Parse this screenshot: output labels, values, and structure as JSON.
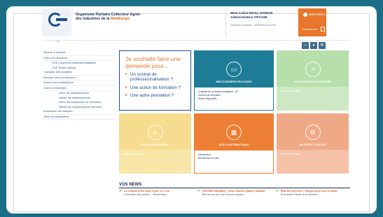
{
  "header": {
    "org_name_line1": "Organisme Paritaire Collecteur Agréé",
    "org_name_line2_prefix": "des Industries de la ",
    "org_name_line2_accent": "Métallurgie",
    "user_name": "Mme Coline MOAL-VIGNON",
    "user_role": "Administrateur OPCAIM",
    "last_connection": "Dernière connexion : 05/02/2015 à 23:54",
    "profile_label": "MON PROFIL",
    "logout_label": "Déconnexion"
  },
  "quick_icons": [
    "home-icon",
    "bell-icon",
    "mail-icon"
  ],
  "sidebar": {
    "items": [
      {
        "label": "Revenir à l'accueil",
        "level": 0
      },
      {
        "label": "Faire une demande",
        "level": 0
      },
      {
        "label": "SGE Contrat de professionnalisation",
        "level": 1
      },
      {
        "label": "SGE Toutes actions",
        "level": 1
      },
      {
        "label": "Consulter mes dossiers",
        "level": 0
      },
      {
        "label": "Déclarer mes contributions",
        "level": 0
      },
      {
        "label": "Suivre mes contributions",
        "level": 0
      },
      {
        "label": "Gérer le référentiel",
        "level": 0
      },
      {
        "label": "Gérer les établissements",
        "level": 1
      },
      {
        "label": "Valider les établissements",
        "level": 1
      },
      {
        "label": "Gérer les organismes de formation",
        "level": 1
      },
      {
        "label": "Valider les organismes de formation",
        "level": 1
      },
      {
        "label": "Administrer les comptes",
        "level": 0
      },
      {
        "label": "Gérer les paramètres",
        "level": 0
      }
    ]
  },
  "callout": {
    "title": "Je souhaite faire une demande pour...",
    "items": [
      "Un contrat de professionnalisation ?",
      "Une action de formation ?",
      "Une autre prestation ?"
    ]
  },
  "tiles": {
    "dossiers": {
      "label": "MES DOSSIERS EN COURS",
      "lines": [
        "Contrats de professionnalisation : 42",
        "Actions de formation",
        "Autres dispositifs"
      ]
    },
    "synthese": {
      "label": "MA SYNTHÈSE FINANCIÈRE",
      "lines": [
        "Bientôt disponible..."
      ]
    },
    "finance": {
      "label": "MES FINANCEMENTS",
      "lines": [
        "Bientôt disponible..."
      ]
    },
    "contributions": {
      "label": "MES CONTRIBUTIONS",
      "lines": [
        "Déclaration",
        "Bordereaux et suivi"
      ]
    },
    "outils": {
      "label": "MA BOITE À OUTILS",
      "lines": [
        "Bientôt disponible..."
      ]
    }
  },
  "news": {
    "title": "VOS NEWS",
    "items": [
      {
        "head": "La version a été mise à jour V.1.1.18",
        "text": "Correction des points : - Bordereaux"
      },
      {
        "head": "OPCAIM Solutions : Votre nouvel espace extranet",
        "text": "Bienvenue sur votre nouvel espace"
      },
      {
        "head": "État des services : Cliquez pour voir le détail",
        "text": "État actuel Heure de la dernière"
      }
    ]
  }
}
